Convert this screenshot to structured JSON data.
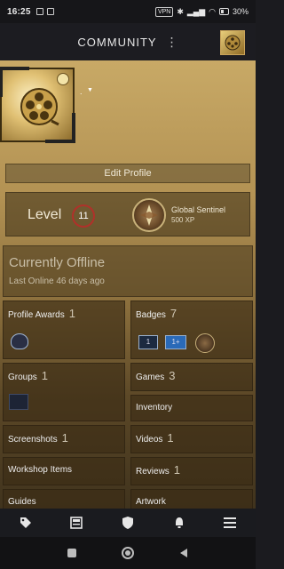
{
  "status_bar": {
    "time": "16:25",
    "battery": "30%",
    "vpn": "VPN"
  },
  "header": {
    "title": "COMMUNITY",
    "menu_glyph": "⋮"
  },
  "profile": {
    "persona_name": ".",
    "edit_profile_label": "Edit Profile",
    "level_label": "Level",
    "level_value": "11",
    "badge_name": "Global Sentinel",
    "badge_xp": "500 XP",
    "status_title": "Currently Offline",
    "status_sub": "Last Online 46 days ago"
  },
  "tiles": {
    "profile_awards": {
      "label": "Profile Awards",
      "count": "1"
    },
    "badges": {
      "label": "Badges",
      "count": "7",
      "badge_icons": [
        "1",
        "1+"
      ]
    },
    "groups": {
      "label": "Groups",
      "count": "1"
    },
    "games": {
      "label": "Games",
      "count": "3"
    },
    "inventory": {
      "label": "Inventory"
    },
    "screenshots": {
      "label": "Screenshots",
      "count": "1"
    },
    "videos": {
      "label": "Videos",
      "count": "1"
    },
    "workshop": {
      "label": "Workshop Items"
    },
    "reviews": {
      "label": "Reviews",
      "count": "1"
    },
    "guides": {
      "label": "Guides"
    },
    "artwork": {
      "label": "Artwork"
    }
  },
  "bottom_nav": [
    "tag-icon",
    "news-icon",
    "shield-icon",
    "bell-icon",
    "menu-icon"
  ],
  "android_nav": [
    "recents-square-icon",
    "home-circle-icon",
    "back-triangle-icon"
  ]
}
